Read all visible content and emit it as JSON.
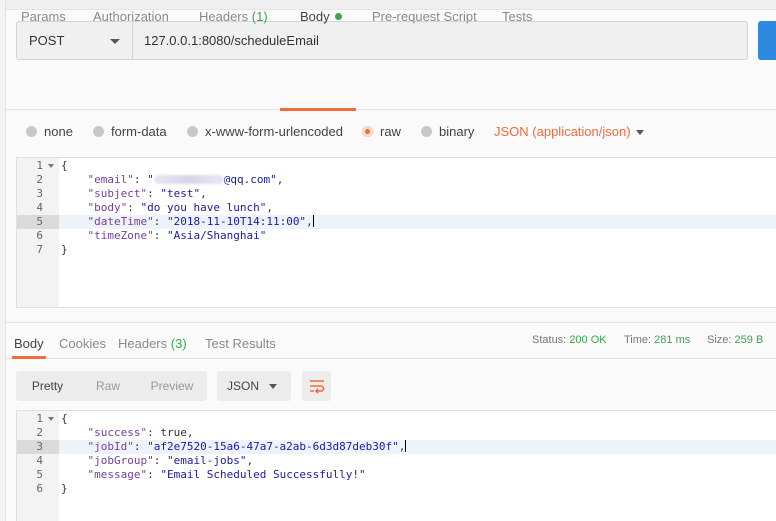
{
  "request": {
    "method": "POST",
    "url": "127.0.0.1:8080/scheduleEmail",
    "tabs": [
      {
        "label": "Params"
      },
      {
        "label": "Authorization"
      },
      {
        "label": "Headers",
        "count": "(1)"
      },
      {
        "label": "Body",
        "active": true
      },
      {
        "label": "Pre-request Script"
      },
      {
        "label": "Tests"
      }
    ],
    "body_types": [
      "none",
      "form-data",
      "x-www-form-urlencoded",
      "raw",
      "binary"
    ],
    "selected_body_type": "raw",
    "content_type": "JSON (application/json)",
    "editor_lines": [
      {
        "n": "1",
        "text": "{"
      },
      {
        "n": "2",
        "key": "\"email\"",
        "value_visible_suffix": "@qq.com\""
      },
      {
        "n": "3",
        "key": "\"subject\"",
        "value": "\"test\""
      },
      {
        "n": "4",
        "key": "\"body\"",
        "value": "\"do you have lunch\""
      },
      {
        "n": "5",
        "key": "\"dateTime\"",
        "value": "\"2018-11-10T14:11:00\""
      },
      {
        "n": "6",
        "key": "\"timeZone\"",
        "value": "\"Asia/Shanghai\""
      },
      {
        "n": "7",
        "text": "}"
      }
    ]
  },
  "response": {
    "tabs": [
      {
        "label": "Body",
        "active": true
      },
      {
        "label": "Cookies"
      },
      {
        "label": "Headers",
        "count": "(3)"
      },
      {
        "label": "Test Results"
      }
    ],
    "status_label": "Status:",
    "status": "200 OK",
    "time_label": "Time:",
    "time": "281 ms",
    "size_label": "Size:",
    "size": "259 B",
    "view_modes": [
      "Pretty",
      "Raw",
      "Preview"
    ],
    "format": "JSON",
    "editor_lines": [
      {
        "n": "1",
        "text": "{"
      },
      {
        "n": "2",
        "key": "\"success\"",
        "value": "true"
      },
      {
        "n": "3",
        "key": "\"jobId\"",
        "value": "\"af2e7520-15a6-47a7-a2ab-6d3d87deb30f\""
      },
      {
        "n": "4",
        "key": "\"jobGroup\"",
        "value": "\"email-jobs\""
      },
      {
        "n": "5",
        "key": "\"message\"",
        "value": "\"Email Scheduled Successfully!\""
      },
      {
        "n": "6",
        "text": "}"
      }
    ]
  },
  "colors": {
    "accent": "#f26b3a",
    "success": "#3aa551",
    "send": "#2d8ae0"
  }
}
